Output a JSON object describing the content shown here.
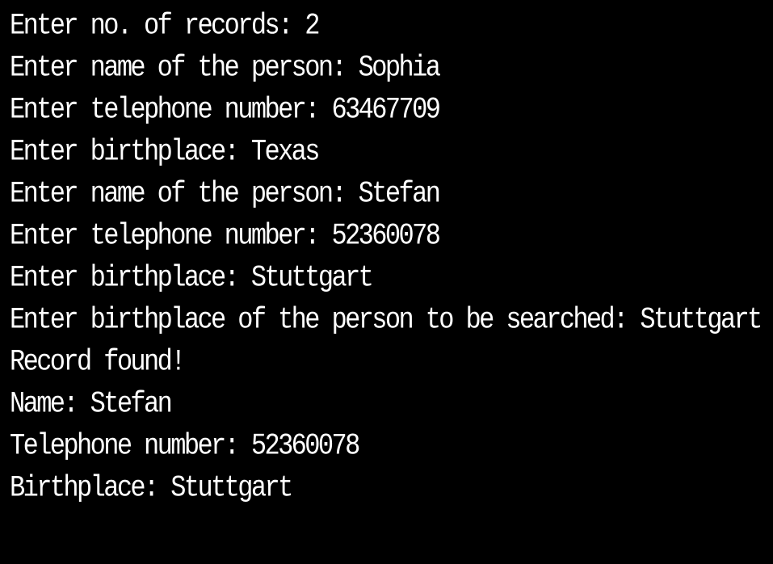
{
  "console": {
    "background": "#000000",
    "text_color": "#ffffff",
    "lines": [
      "Enter no. of records: 2",
      "Enter name of the person: Sophia",
      "Enter telephone number: 63467709",
      "Enter birthplace: Texas",
      "Enter name of the person: Stefan",
      "Enter telephone number: 52360078",
      "Enter birthplace: Stuttgart",
      "Enter birthplace of the person to be searched: Stuttgart",
      "Record found!",
      "Name: Stefan",
      "Telephone number: 52360078",
      "Birthplace: Stuttgart"
    ]
  }
}
